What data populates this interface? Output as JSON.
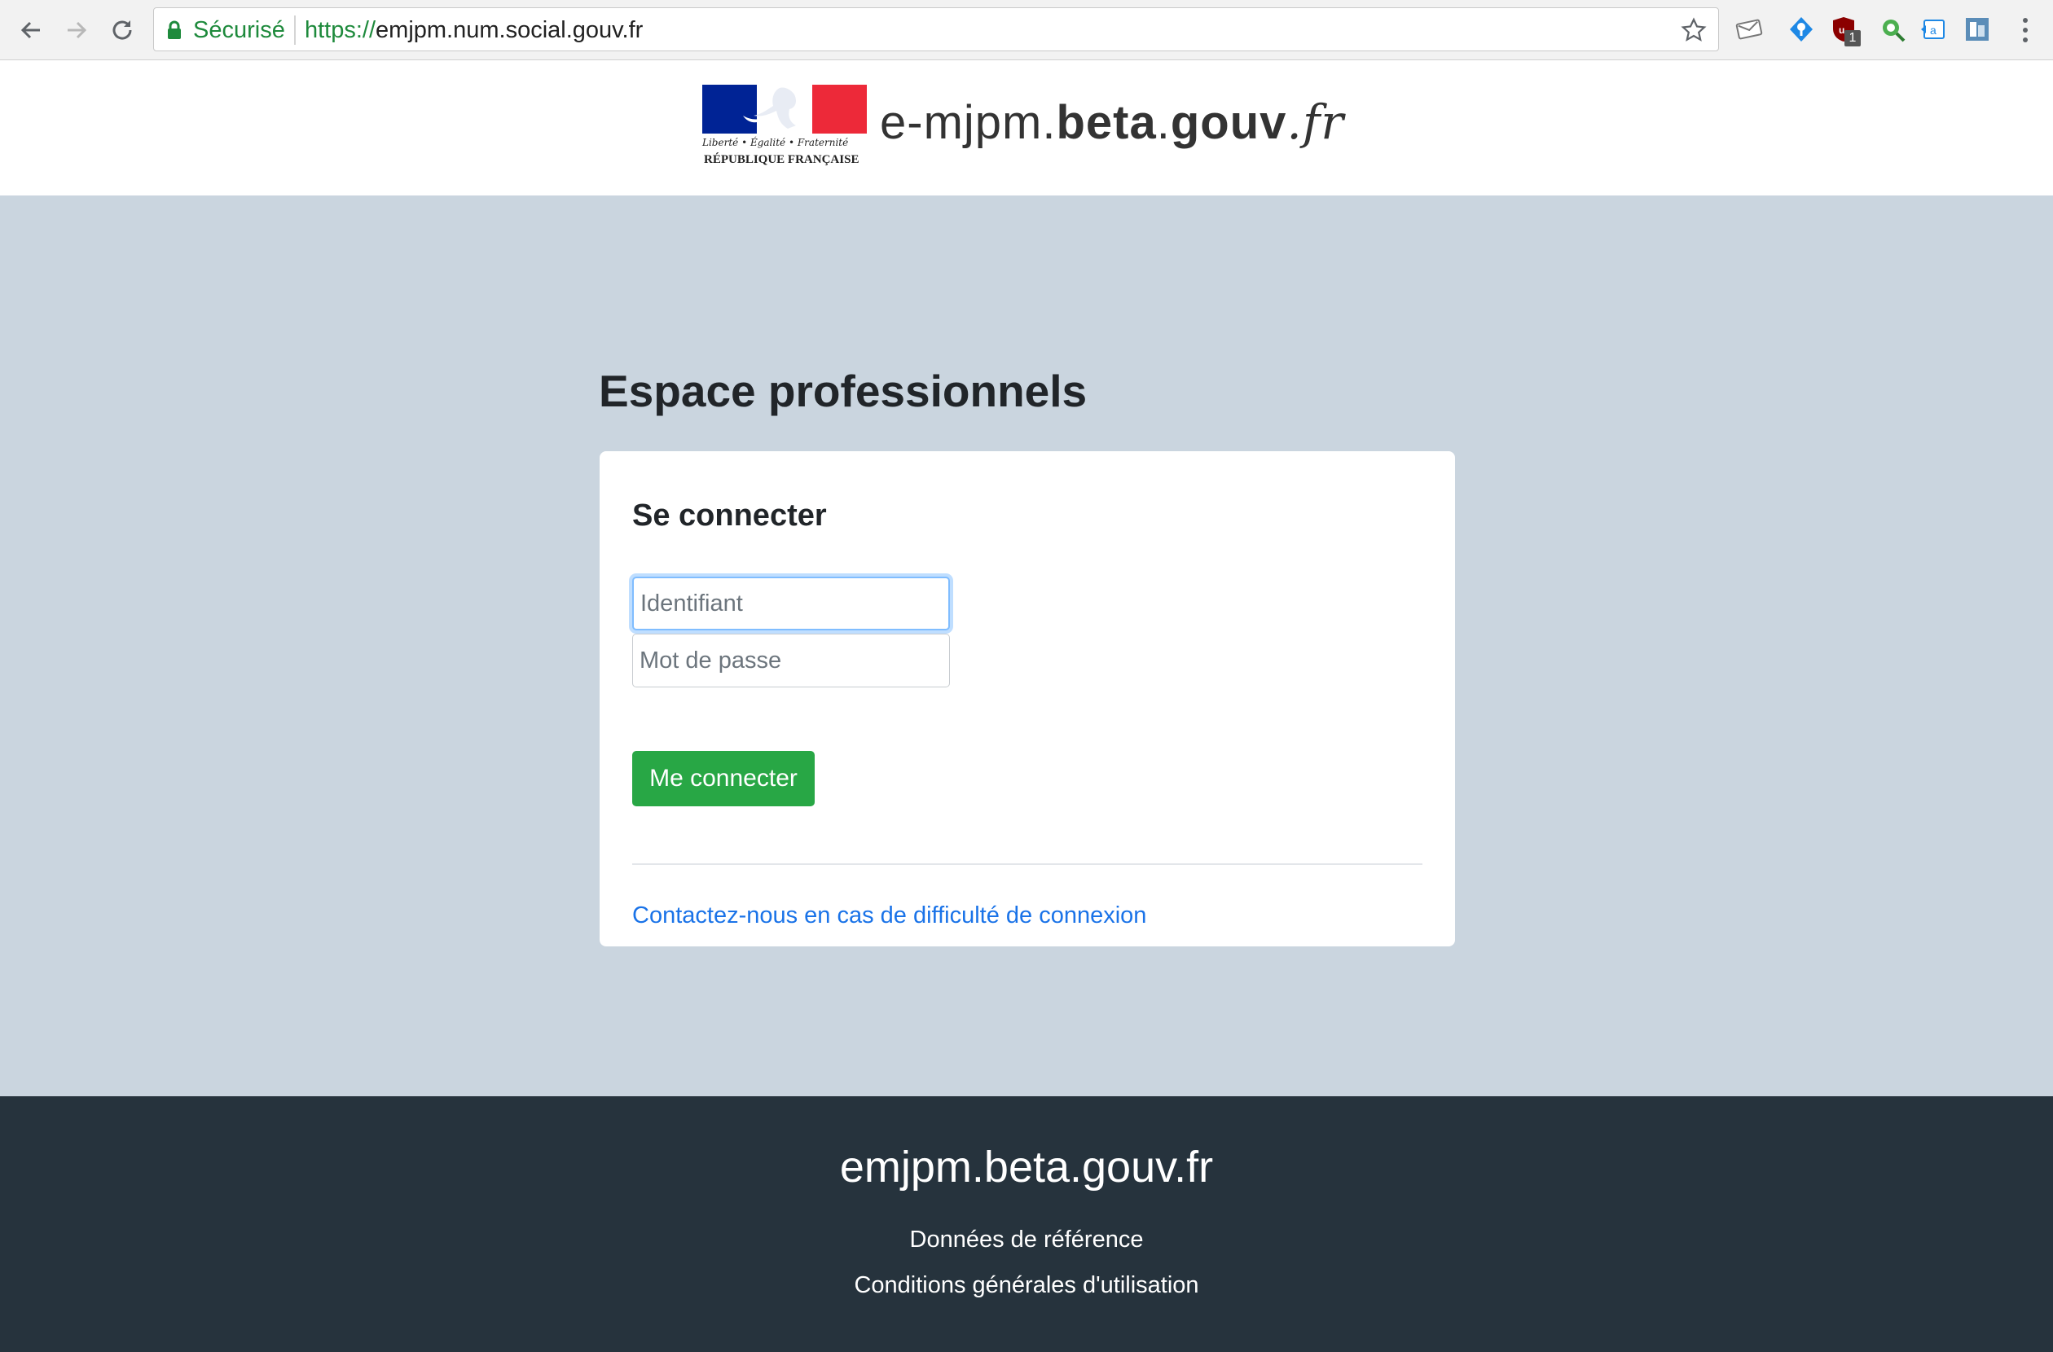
{
  "browser": {
    "secure_label": "Sécurisé",
    "url_protocol": "https://",
    "url_host": "emjpm.num.social.gouv.fr",
    "extensions": [
      "mail-ext-icon",
      "location-pin-ext-icon",
      "ublock-shield-icon",
      "search-ext-icon",
      "translate-ext-icon",
      "notes-ext-icon"
    ],
    "ublock_badge": "1"
  },
  "header": {
    "logo_motto": "Liberté • Égalité • Fraternité",
    "logo_caption": "RÉPUBLIQUE FRANÇAISE",
    "brand_prefix": "e-mjpm.",
    "brand_bold1": "beta",
    "brand_dot": ".",
    "brand_bold2": "gouv",
    "brand_dot2": ".",
    "brand_suffix": "fr"
  },
  "main": {
    "title": "Espace professionnels",
    "login": {
      "heading": "Se connecter",
      "username_placeholder": "Identifiant",
      "password_placeholder": "Mot de passe",
      "submit_label": "Me connecter",
      "help_link": "Contactez-nous en cas de difficulté de connexion"
    }
  },
  "footer": {
    "title": "emjpm.beta.gouv.fr",
    "links": [
      "Données de référence",
      "Conditions générales d'utilisation"
    ]
  },
  "colors": {
    "page_bg": "#cad5df",
    "footer_bg": "#26333d",
    "primary_button": "#28a745",
    "link": "#1a73e8",
    "flag_blue": "#002395",
    "flag_red": "#ed2939"
  }
}
